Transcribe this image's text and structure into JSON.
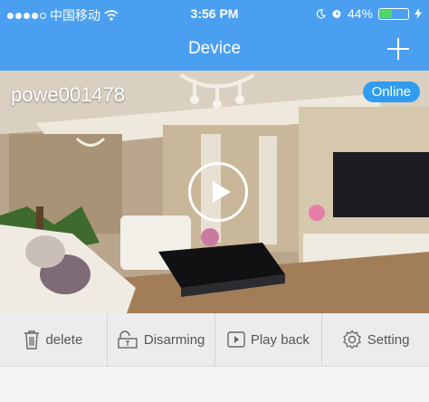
{
  "statusbar": {
    "carrier": "中国移动",
    "time": "3:56 PM",
    "battery_text": "44%",
    "battery_level": 0.44
  },
  "navbar": {
    "title": "Device"
  },
  "device": {
    "name": "powe001478",
    "status": "Online"
  },
  "actions": {
    "delete": "delete",
    "disarming": "Disarming",
    "playback": "Play back",
    "setting": "Setting"
  },
  "colors": {
    "primary": "#4a9ff0",
    "online_badge": "#2f9cf0",
    "battery_fill": "#4cd964"
  }
}
